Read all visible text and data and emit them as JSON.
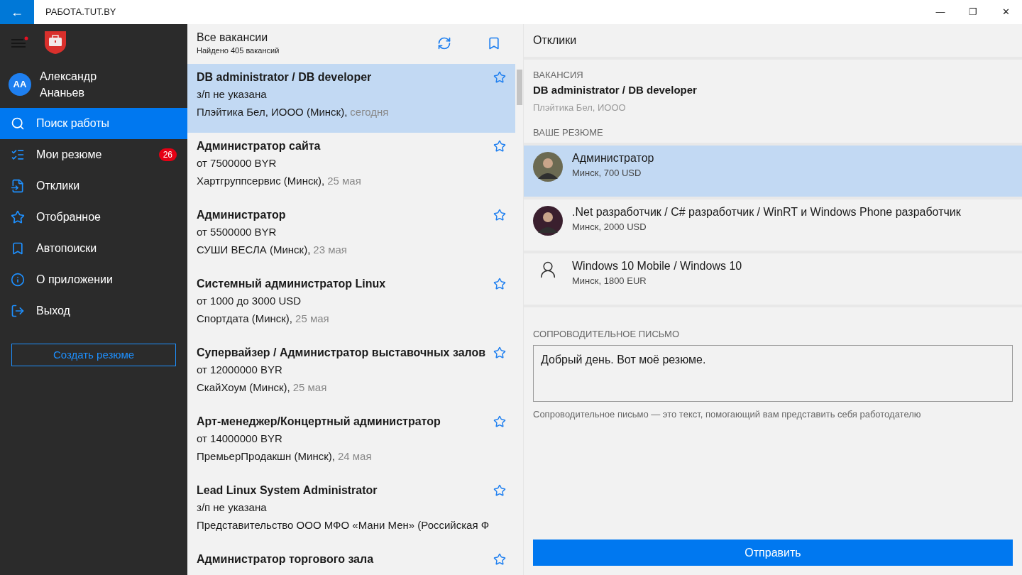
{
  "window": {
    "title": "РАБОТА.TUT.BY",
    "back": "←",
    "controls": [
      "—",
      "❐",
      "✕"
    ]
  },
  "sidebar": {
    "user": {
      "initials": "АА",
      "name": "Александр Ананьев"
    },
    "items": [
      {
        "kind": "search",
        "label": "Поиск работы",
        "selected": true
      },
      {
        "kind": "resumes",
        "label": "Мои резюме",
        "selected": false,
        "badge": "26"
      },
      {
        "kind": "responses",
        "label": "Отклики",
        "selected": false
      },
      {
        "kind": "favorites",
        "label": "Отобранное",
        "selected": false
      },
      {
        "kind": "autosearch",
        "label": "Автопоиски",
        "selected": false
      },
      {
        "kind": "about",
        "label": "О приложении",
        "selected": false
      },
      {
        "kind": "logout",
        "label": "Выход",
        "selected": false
      }
    ],
    "create_button": "Создать резюме"
  },
  "vacancies": {
    "title": "Все вакансии",
    "subtitle": "Найдено 405 вакансий",
    "items": [
      {
        "title": "DB administrator / DB developer",
        "salary": "з/п не указана",
        "company": "Плэйтика Бел, ИООО (Минск),",
        "date": "сегодня",
        "selected": true
      },
      {
        "title": "Администратор сайта",
        "salary": "от 7500000 BYR",
        "company": "Хартгруппсервис (Минск),",
        "date": "25 мая",
        "selected": false
      },
      {
        "title": "Администратор",
        "salary": "от 5500000 BYR",
        "company": "СУШИ ВЕСЛА (Минск),",
        "date": "23 мая",
        "selected": false
      },
      {
        "title": "Системный администратор Linux",
        "salary": "от 1000 до 3000 USD",
        "company": "Спортдата (Минск),",
        "date": "25 мая",
        "selected": false
      },
      {
        "title": "Супервайзер / Администратор выставочных залов",
        "salary": "от 12000000 BYR",
        "company": "СкайХоум (Минск),",
        "date": "25 мая",
        "selected": false
      },
      {
        "title": "Арт-менеджер/Концертный администратор",
        "salary": "от 14000000 BYR",
        "company": "ПремьерПродакшн (Минск),",
        "date": "24 мая",
        "selected": false
      },
      {
        "title": "Lead Linux System Administrator",
        "salary": "з/п не указана",
        "company": "Представительство ООО МФО «Мани Мен» (Российская Ф",
        "selected": false
      },
      {
        "title": "Администратор торгового зала",
        "selected": false
      }
    ]
  },
  "responses": {
    "title": "Отклики",
    "vacancy_label": "ВАКАНСИЯ",
    "vacancy_title": "DB administrator / DB developer",
    "vacancy_company": "Плэйтика Бел, ИООО",
    "resume_label": "ВАШЕ РЕЗЮМЕ",
    "resumes": [
      {
        "kind": "photo",
        "title": "Администратор",
        "details": "Минск, 700 USD",
        "selected": true
      },
      {
        "kind": "photo",
        "title": ".Net разработчик / C# разработчик / WinRT и Windows Phone разработчик",
        "details": "Минск, 2000 USD",
        "selected": false
      },
      {
        "kind": "default",
        "title": "Windows 10 Mobile / Windows 10",
        "details": "Минск, 1800 EUR",
        "selected": false
      }
    ],
    "letter_label": "СОПРОВОДИТЕЛЬНОЕ ПИСЬМО",
    "letter_value": "Добрый день. Вот моё резюме.",
    "letter_hint": "Сопроводительное письмо — это текст, помогающий вам представить себя работодателю",
    "send_button": "Отправить"
  }
}
